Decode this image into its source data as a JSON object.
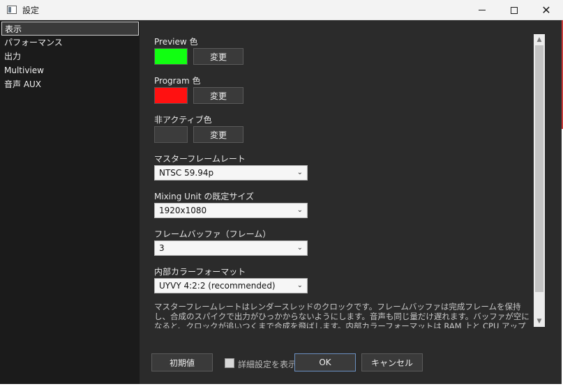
{
  "window": {
    "title": "設定"
  },
  "sidebar": {
    "items": [
      {
        "label": "表示",
        "selected": true
      },
      {
        "label": "パフォーマンス",
        "selected": false
      },
      {
        "label": "出力",
        "selected": false
      },
      {
        "label": "Multiview",
        "selected": false
      },
      {
        "label": "音声 AUX",
        "selected": false
      }
    ]
  },
  "settings": {
    "preview": {
      "label": "Preview 色",
      "color": "#11ff11",
      "button": "変更"
    },
    "program": {
      "label": "Program 色",
      "color": "#ff1111",
      "button": "変更"
    },
    "inactive": {
      "label": "非アクティブ色",
      "color": "#3c3c3c",
      "button": "変更"
    },
    "frame_rate": {
      "label": "マスターフレームレート",
      "value": "NTSC 59.94p"
    },
    "mixing_unit_size": {
      "label": "Mixing Unit の既定サイズ",
      "value": "1920x1080"
    },
    "frame_buffer": {
      "label": "フレームバッファ（フレーム）",
      "value": "3"
    },
    "color_format": {
      "label": "内部カラーフォーマット",
      "value": "UYVY 4:2:2 (recommended)"
    }
  },
  "description": "マスターフレームレートはレンダースレッドのクロックです。フレームバッファは完成フレームを保持し、合成のスパイクで出力がひっかからないようにします。音声も同じ量だけ遅れます。バッファが空になると、クロックが追いつくまで合成を飛ばします。内部カラーフォーマットは RAM 上と CPU アップロードの帯をすます。UYVY は RGBA の半分のサイズで、実際に合",
  "footer": {
    "reset_label": "初期値",
    "advanced_label": "詳細設定を表示",
    "ok_label": "OK",
    "cancel_label": "キャンセル"
  },
  "icons": {
    "chevron": "chevron-down-icon",
    "scroll_up": "scroll-up-arrow-icon",
    "scroll_down": "scroll-down-arrow-icon"
  }
}
